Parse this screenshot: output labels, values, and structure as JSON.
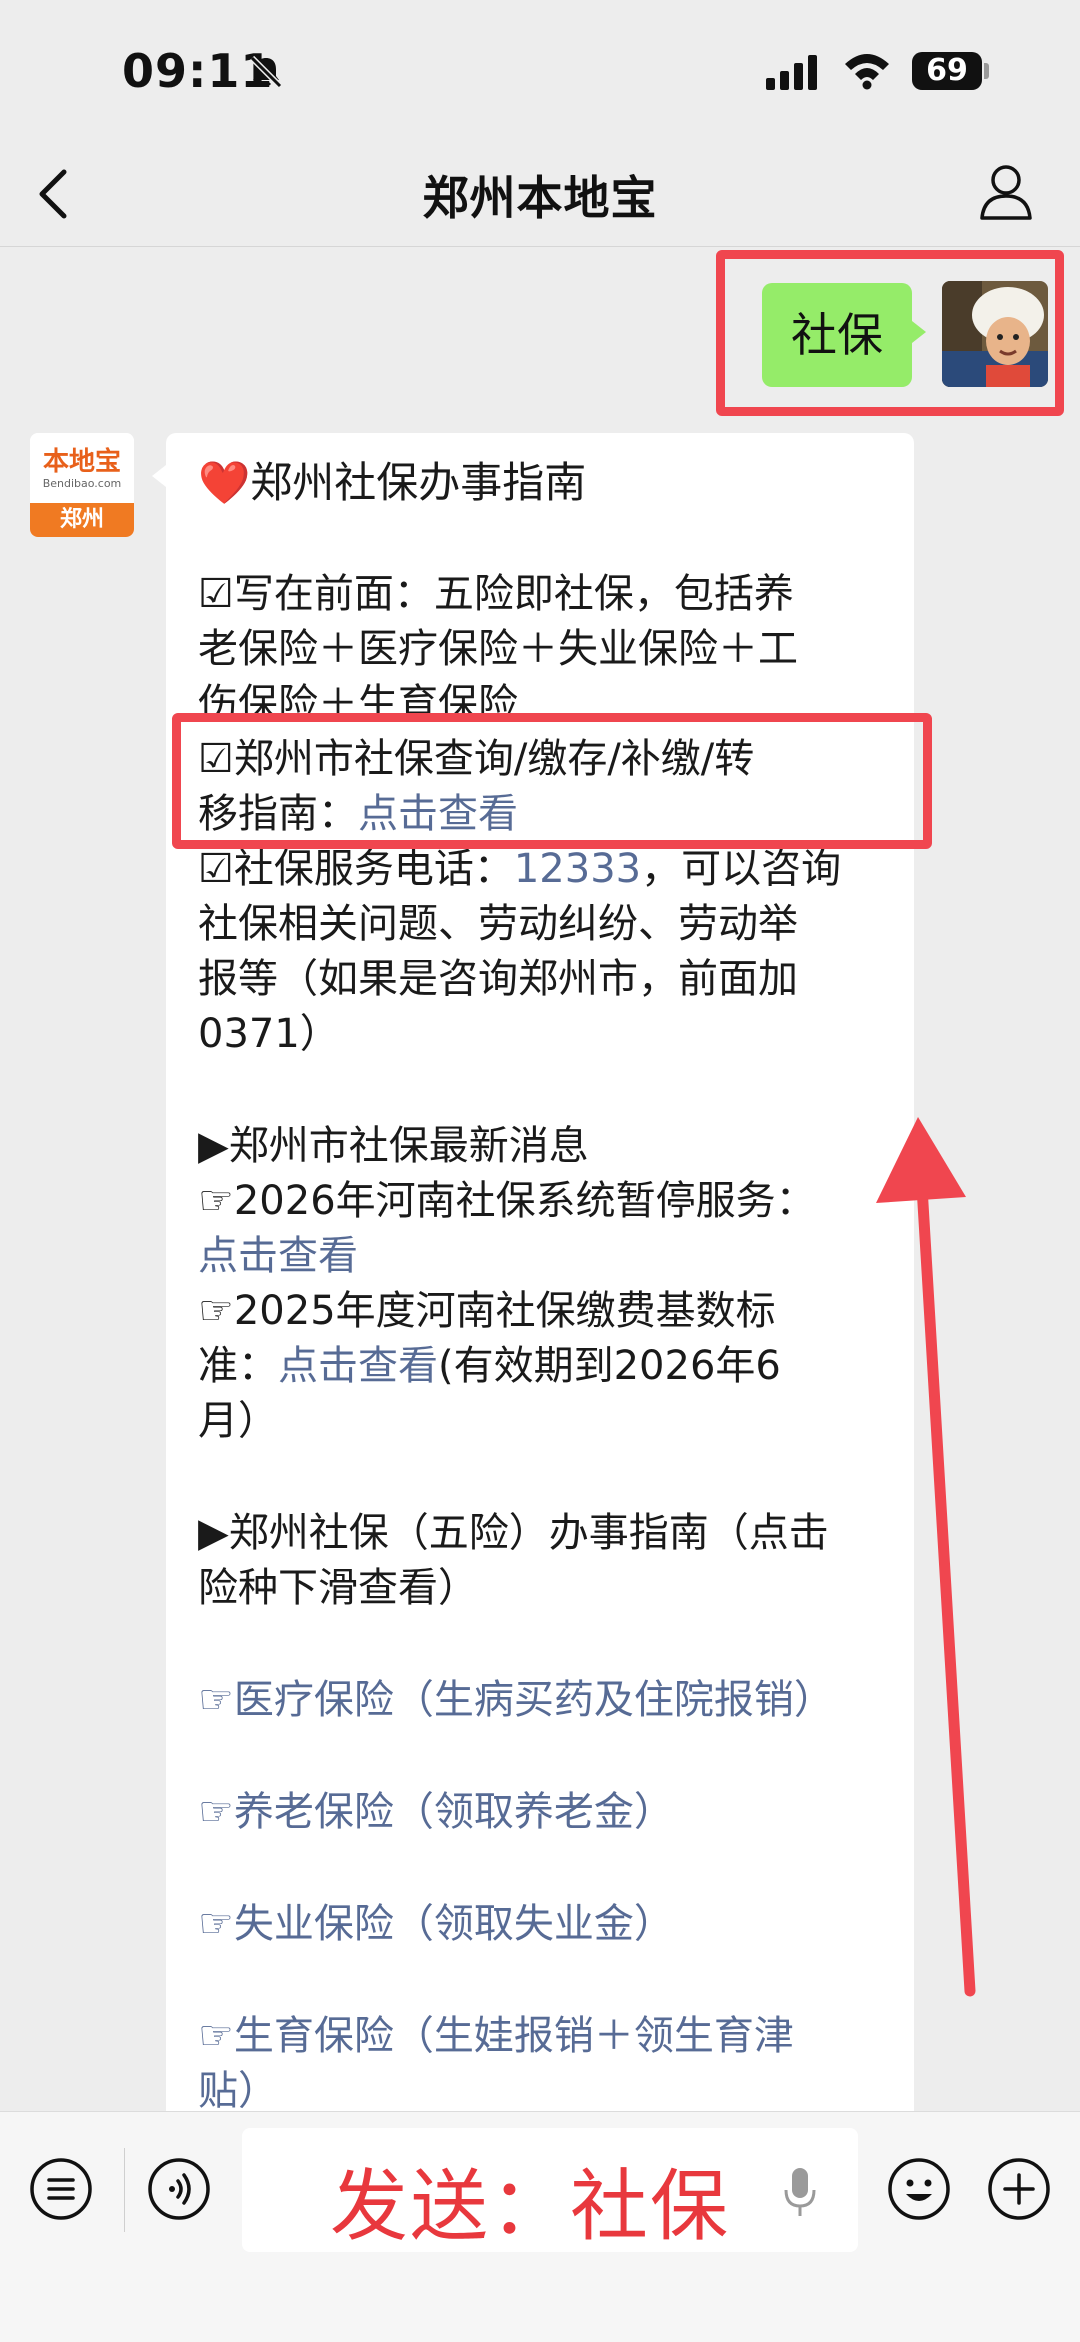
{
  "status_bar": {
    "time": "09:11",
    "battery": "69"
  },
  "nav": {
    "title": "郑州本地宝"
  },
  "sent_message": {
    "text": "社保"
  },
  "bot": {
    "logo_main": "本地宝",
    "logo_sub": "Bendibao.com",
    "logo_city": "郑州"
  },
  "reply": {
    "title": "❤️郑州社保办事指南",
    "intro_1": "☑写在前面：五险即社保，包括养",
    "intro_2": "老保险＋医疗保险＋失业保险＋工",
    "intro_3": "伤保险＋生育保险",
    "guide_1": "☑郑州市社保查询/缴存/补缴/转",
    "guide_2_prefix": "移指南：",
    "guide_2_link": "点击查看",
    "phone_prefix": "☑社保服务电话：",
    "phone_number": "12333",
    "phone_suffix": "，可以咨询",
    "phone_2": "社保相关问题、劳动纠纷、劳动举",
    "phone_3": "报等（如果是咨询郑州市，前面加",
    "phone_4": "0371）",
    "news_heading": "▶郑州市社保最新消息",
    "news_1": "☞2026年河南社保系统暂停服务：",
    "news_1_link": "点击查看",
    "news_2": "☞2025年度河南社保缴费基数标",
    "news_2b_prefix": "准：",
    "news_2b_link": "点击查看",
    "news_2b_suffix": "(有效期到2026年6",
    "news_2c": "月）",
    "guide_heading_1": "▶郑州社保（五险）办事指南（点击",
    "guide_heading_2": "险种下滑查看）",
    "link_medical": "☞医疗保险（生病买药及住院报销）",
    "link_pension": "☞养老保险（领取养老金）",
    "link_unemployment": "☞失业保险（领取失业金）",
    "link_maternity_1": "☞生育保险（生娃报销＋领生育津",
    "link_maternity_2": "贴）"
  },
  "input_bar": {
    "send_hint": "发送：社保"
  },
  "colors": {
    "highlight": "#f0464f",
    "link": "#576b95",
    "sent_bubble": "#95ec69",
    "hint_red": "#e8383d"
  }
}
